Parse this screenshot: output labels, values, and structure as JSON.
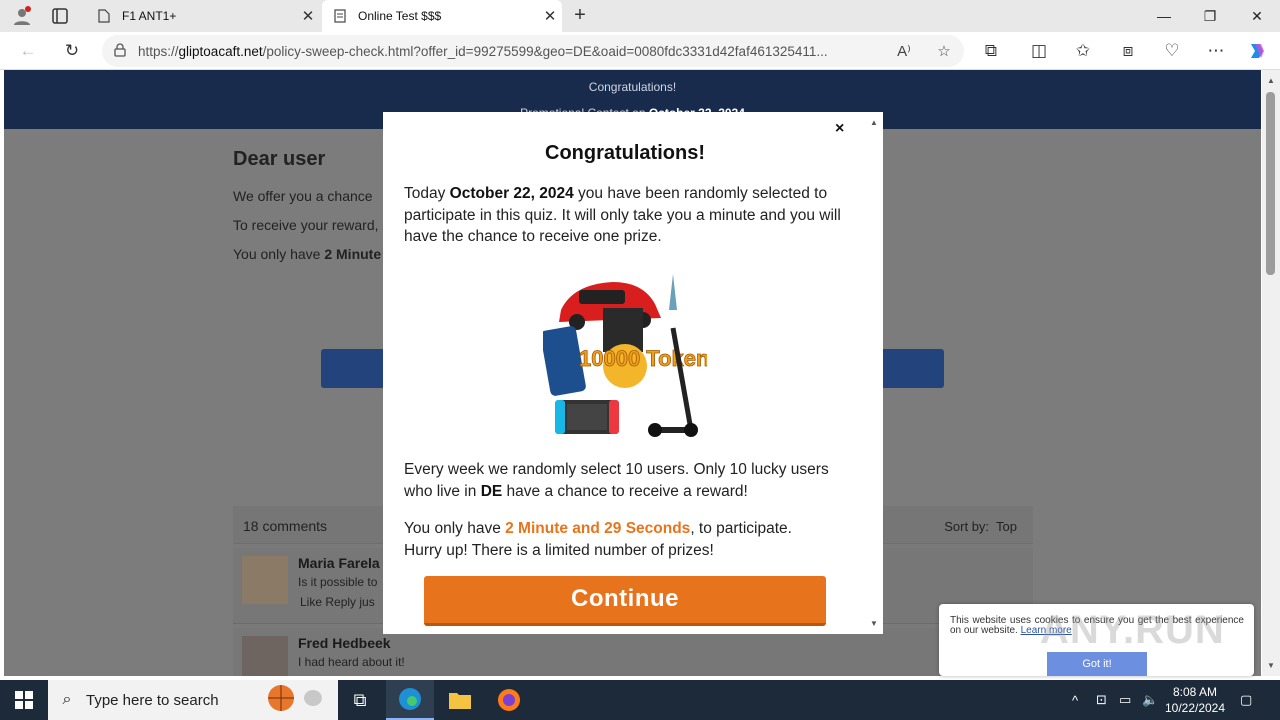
{
  "browser": {
    "tabs": [
      {
        "label": "F1 ANT1+",
        "active": false
      },
      {
        "label": "Online Test $$$",
        "active": true
      }
    ],
    "url_domain": "gliptoacaft.net",
    "url_prefix": "https://",
    "url_path": "/policy-sweep-check.html?offer_id=99275599&geo=DE&oaid=0080fdc3331d42faf461325411..."
  },
  "page": {
    "header_line1": "Congratulations!",
    "header_line2_prefix": "Promotional Contest on ",
    "header_line2_date": "October 22, 2024",
    "heading": "Dear user",
    "p1": "We offer you a chance",
    "p2": "To receive your reward,",
    "p3_prefix": "You only have ",
    "p3_bold": "2 Minute",
    "comments_count": "18 comments",
    "sort_label": "Sort by:",
    "sort_value": "Top",
    "comments": [
      {
        "name": "Maria Farela",
        "text": "Is it possible to",
        "actions": "Like Reply  jus"
      },
      {
        "name": "Fred Hedbeek",
        "text": "I had heard about it!",
        "actions": ""
      }
    ]
  },
  "modal": {
    "close": "×",
    "title": "Congratulations!",
    "p1_a": "Today ",
    "p1_date": "October 22, 2024",
    "p1_b": " you have been randomly selected to participate in this quiz. It will only take you a minute and you will have the chance to receive one prize.",
    "prize_text": "10000 Tokens",
    "p2_a": "Every week we randomly select 10 users. Only 10 lucky users who live in ",
    "p2_geo": "DE",
    "p2_b": " have a chance to receive a reward!",
    "p3_a": "You only have ",
    "p3_timer": "2 Minute and 29 Seconds",
    "p3_b": ", to participate.",
    "p3_c": "Hurry up! There is a limited number of prizes!",
    "button": "Continue",
    "accent_color": "#e8731d"
  },
  "cookie": {
    "text": "This website uses cookies to ensure you get the best experience on our website.",
    "link": "Learn more",
    "button": "Got it!"
  },
  "watermark": "ANY.RUN",
  "taskbar": {
    "search_placeholder": "Type here to search",
    "time": "8:08 AM",
    "date": "10/22/2024"
  }
}
